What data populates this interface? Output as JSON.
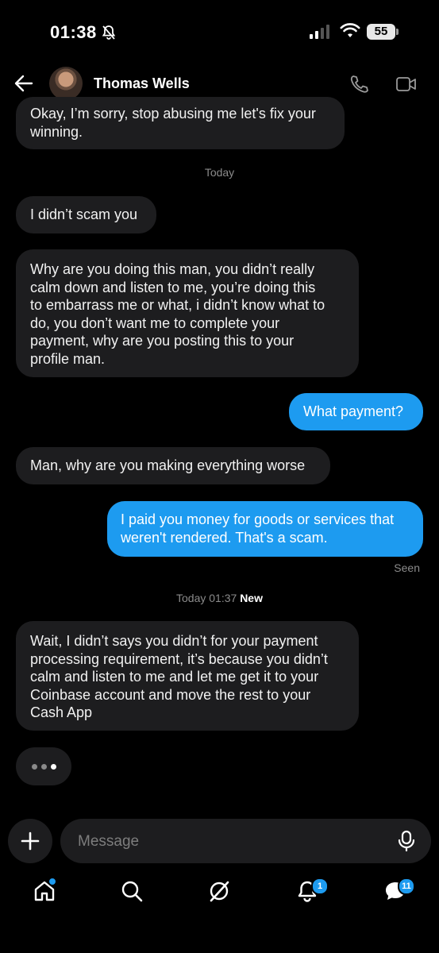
{
  "status_bar": {
    "time": "01:38",
    "battery": "55"
  },
  "header": {
    "contact_name": "Thomas Wells"
  },
  "messages": [
    {
      "side": "in",
      "text": "Okay, I’m sorry, stop abusing me let's fix your\nwinning."
    },
    {
      "side": "in",
      "text": "I didn’t scam you"
    },
    {
      "side": "in",
      "text": "Why are you doing this man, you didn’t really\ncalm down and listen to me, you’re doing this\nto embarrass me or what, i didn’t know what to\ndo, you don’t want me to complete your\npayment, why are you posting this to your\nprofile man."
    },
    {
      "side": "out",
      "text": "What payment?"
    },
    {
      "side": "in",
      "text": "Man, why are you making everything worse"
    },
    {
      "side": "out",
      "text": "I paid you money for goods or services that\nweren't rendered. That's a scam."
    },
    {
      "side": "in",
      "text": "Wait, I didn’t says you didn’t for your payment\nprocessing requirement, it’s because you didn’t\ncalm and listen to me and let me get it to your\nCoinbase account and move the rest to your\nCash App"
    }
  ],
  "separators": {
    "today": "Today",
    "today_time": "Today 01:37",
    "new_label": "New"
  },
  "seen_label": "Seen",
  "composer": {
    "placeholder": "Message"
  },
  "nav": {
    "notifications_badge": "1",
    "messages_badge": "11"
  },
  "colors": {
    "accent": "#1d9bf0",
    "incoming_bubble": "#1d1d1f",
    "background": "#000000"
  },
  "icons": [
    "bell-slash-icon",
    "signal-icon",
    "wifi-icon",
    "battery-icon",
    "back-arrow-icon",
    "phone-icon",
    "video-icon",
    "plus-icon",
    "mic-icon",
    "home-icon",
    "search-icon",
    "grok-icon",
    "notifications-icon",
    "messages-icon"
  ]
}
